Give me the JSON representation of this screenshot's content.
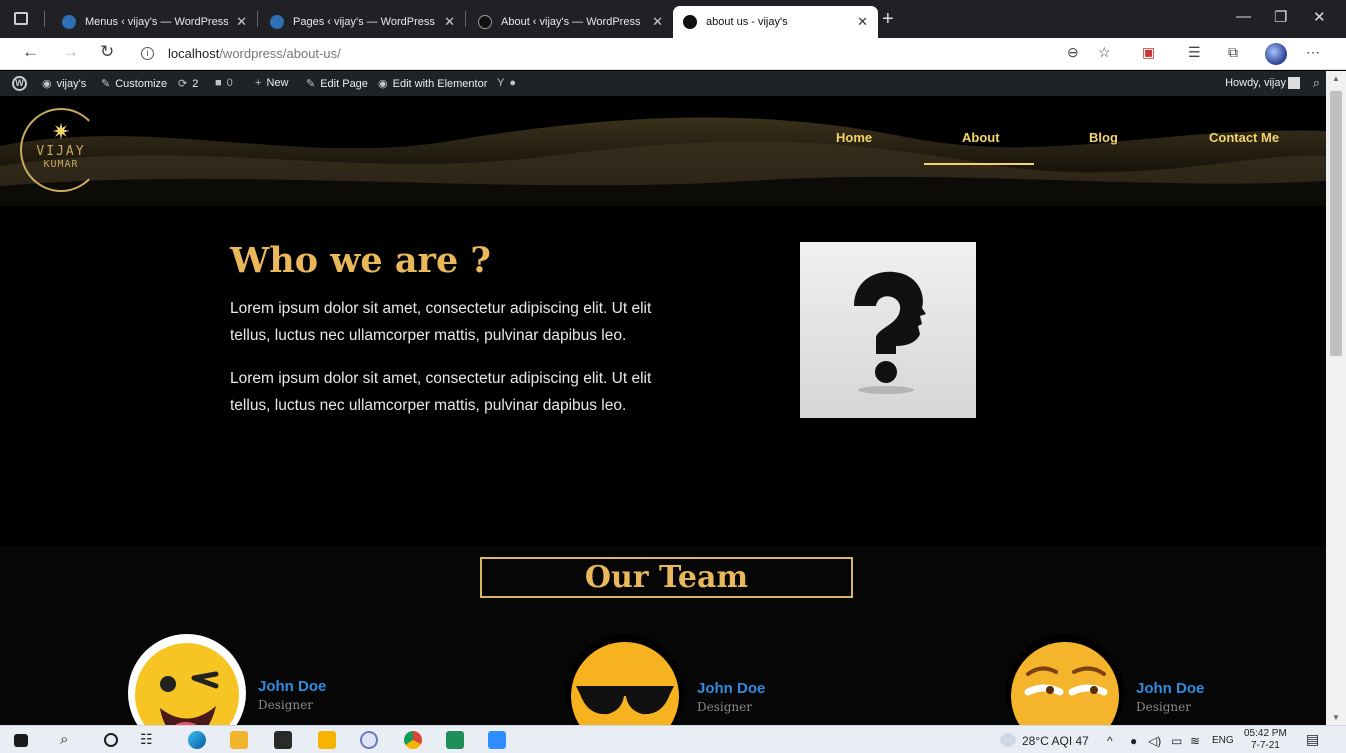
{
  "browser": {
    "tabs": [
      {
        "label": "Menus ‹ vijay's — WordPress"
      },
      {
        "label": "Pages ‹ vijay's — WordPress"
      },
      {
        "label": "About ‹ vijay's — WordPress"
      },
      {
        "label": "about us - vijay's"
      }
    ],
    "url_host": "localhost",
    "url_path": "/wordpress/about-us/"
  },
  "adminbar": {
    "site": "vijay's",
    "customize": "Customize",
    "updates": "2",
    "comments": "0",
    "new": "New",
    "edit_page": "Edit Page",
    "elementor": "Edit with Elementor",
    "howdy": "Howdy, vijay"
  },
  "site": {
    "logo_line1": "VIJAY",
    "logo_line2": "KUMAR",
    "nav": [
      "Home",
      "About",
      "Blog",
      "Contact Me"
    ]
  },
  "about": {
    "title": "Who we are ?",
    "para1": "Lorem ipsum dolor sit amet, consectetur adipiscing elit. Ut elit tellus, luctus nec ullamcorper mattis, pulvinar dapibus leo.",
    "para2": "Lorem ipsum dolor sit amet, consectetur adipiscing elit. Ut elit tellus, luctus nec ullamcorper mattis, pulvinar dapibus leo."
  },
  "team": {
    "title": "Our Team",
    "members": [
      {
        "name": "John Doe",
        "role": "Designer"
      },
      {
        "name": "John Doe",
        "role": "Designer"
      },
      {
        "name": "John Doe",
        "role": "Designer"
      }
    ]
  },
  "taskbar": {
    "weather": "28°C  AQI 47",
    "language": "ENG",
    "time": "05:42 PM",
    "date": "7-7-21"
  }
}
